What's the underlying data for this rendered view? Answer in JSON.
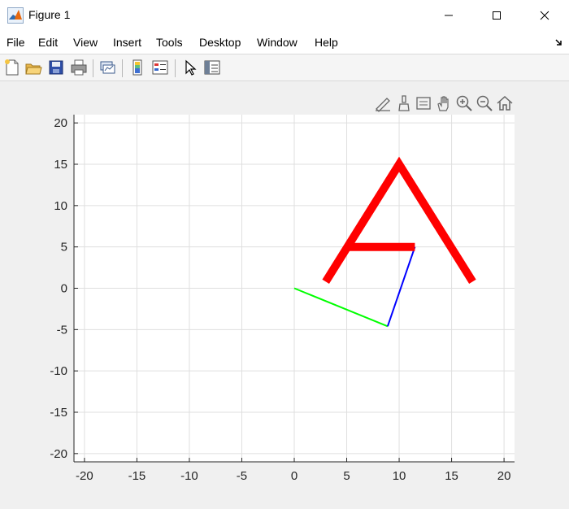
{
  "window": {
    "title": "Figure 1"
  },
  "menu": [
    "File",
    "Edit",
    "View",
    "Insert",
    "Tools",
    "Desktop",
    "Window",
    "Help"
  ],
  "toolbar_icons": [
    "new-figure-icon",
    "open-file-icon",
    "save-icon",
    "print-icon",
    "link-plot-icon",
    "insert-colorbar-icon",
    "insert-legend-icon",
    "edit-plot-icon",
    "property-inspector-icon"
  ],
  "axes_toolbar_icons": [
    "edit-label-icon",
    "brush-icon",
    "datatip-icon",
    "pan-icon",
    "zoom-in-icon",
    "zoom-out-icon",
    "home-icon"
  ],
  "colors": {
    "red": "#ff0000",
    "blue": "#0000ff",
    "green": "#00ff00"
  },
  "chart_data": {
    "type": "line",
    "title": "",
    "xlabel": "",
    "ylabel": "",
    "xlim": [
      -21,
      21
    ],
    "ylim": [
      -21,
      21
    ],
    "grid": true,
    "xticks": [
      -20,
      -15,
      -10,
      -5,
      0,
      5,
      10,
      15,
      20
    ],
    "yticks": [
      -20,
      -15,
      -10,
      -5,
      0,
      5,
      10,
      15,
      20
    ],
    "series": [
      {
        "color": "#00ff00",
        "width": 2,
        "points": [
          [
            0,
            0
          ],
          [
            8.9,
            -4.6
          ]
        ]
      },
      {
        "color": "#0000ff",
        "width": 2,
        "points": [
          [
            8.9,
            -4.6
          ],
          [
            11.5,
            5
          ]
        ]
      },
      {
        "color": "#ff0000",
        "width": 10,
        "points": [
          [
            3,
            0.8
          ],
          [
            10,
            15
          ],
          [
            17,
            0.8
          ]
        ]
      },
      {
        "color": "#ff0000",
        "width": 10,
        "points": [
          [
            5,
            5
          ],
          [
            11.5,
            5
          ]
        ]
      }
    ]
  }
}
